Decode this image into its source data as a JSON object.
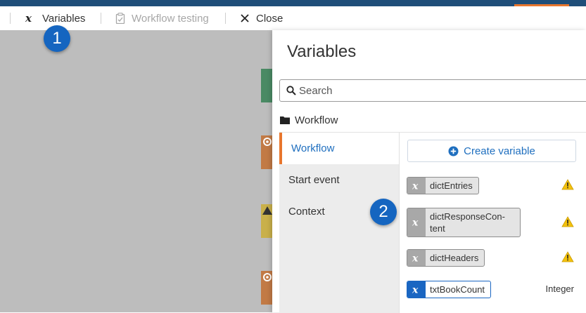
{
  "toolbar": {
    "variables_label": "Variables",
    "workflow_testing_label": "Workflow testing",
    "close_label": "Close"
  },
  "callouts": {
    "first": "1",
    "second": "2"
  },
  "panel": {
    "title": "Variables",
    "search_placeholder": "Search",
    "breadcrumb": "Workflow",
    "sidebar": [
      {
        "label": "Workflow",
        "active": true
      },
      {
        "label": "Start event",
        "active": false
      },
      {
        "label": "Context",
        "active": false
      }
    ],
    "create_label": "Create variable",
    "variables": [
      {
        "name": "dictEntries",
        "type": "",
        "warning": true
      },
      {
        "name": "dictResponseCon-tent",
        "type": "",
        "warning": true
      },
      {
        "name": "dictHeaders",
        "type": "",
        "warning": true
      },
      {
        "name": "txtBookCount",
        "type": "Integer",
        "warning": false
      }
    ]
  },
  "colors": {
    "header_bar": "#1f4e79",
    "accent_orange": "#e8762d",
    "link_blue": "#1f6fbf",
    "callout_blue": "#1565c0",
    "warning_yellow": "#f4c20d"
  }
}
